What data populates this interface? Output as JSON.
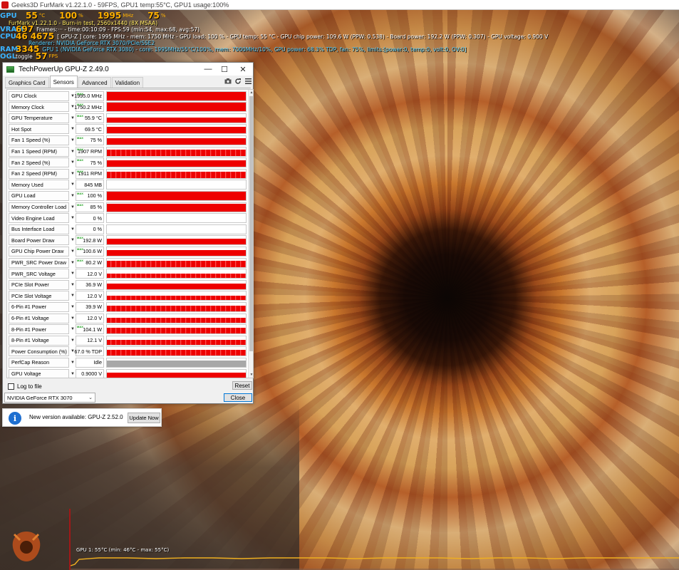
{
  "furmark": {
    "window_title": "Geeks3D FurMark v1.22.1.0 - 59FPS, GPU1 temp:55°C, GPU1 usage:100%",
    "osd": {
      "gpu_label": "GPU",
      "gpu_temp": "55",
      "gpu_temp_unit": "°C",
      "gpu_usage": "100",
      "gpu_usage_unit": "%",
      "gpu_clock": "1995",
      "gpu_clock_unit": "MHz",
      "fan": "75",
      "fan_unit": "%",
      "line1": "FurMark v1.22.1.0 - Burn-in test, 2560x1440 (8X MSAA)",
      "vram_label": "VRAM",
      "vram_value": "697",
      "line2": "Frames:··· - time:00:10:09 - FPS:59 (min:54, max:68, avg:57)",
      "cpu_label": "CPU",
      "cpu_value": "46",
      "cpu_value2": "4675",
      "line3": "[ GPU-Z ] core: 1995 MHz - mem: 1750 MHz - GPU load: 100 % - GPU temp: 55 °C - GPU chip power: 109.6 W (PPW: 0.538) - Board power: 192.2 W (PPW: 0.307) - GPU voltage: 0.900 V",
      "line4": "Renderer: NVIDIA GeForce RTX 3070/PCIe/SSE2",
      "ram_label": "RAM",
      "ram_value": "3345",
      "line5": "GPU 1 (NVIDIA GeForce RTX 3080) - core: 1995MHz/55°C/100%, mem: 7000MHz/10%, GPU power: 68.3% TDP, fan: 75%, limits:[power:0, temp:0, volt:0, OV:0]",
      "ogl_label": "OGL",
      "ogl_value": "57",
      "ogl_unit": "FPS",
      "toggle_text": "toggle"
    },
    "graph_label": "GPU 1: 55°C (min: 46°C - max: 55°C)"
  },
  "gpuz": {
    "title": "TechPowerUp GPU-Z 2.49.0",
    "min_glyph": "—",
    "max_glyph": "☐",
    "close_glyph": "✕",
    "tabs": [
      {
        "label": "Graphics Card",
        "active": false
      },
      {
        "label": "Sensors",
        "active": true
      },
      {
        "label": "Advanced",
        "active": false
      },
      {
        "label": "Validation",
        "active": false
      }
    ],
    "toolbar_icons": [
      "camera-icon",
      "refresh-icon",
      "menu-icon"
    ],
    "sensors": [
      {
        "name": "GPU Clock",
        "value": "1995.0 MHz",
        "max": true,
        "fill": 0.98,
        "style": "solid"
      },
      {
        "name": "Memory Clock",
        "value": "1750.2 MHz",
        "max": true,
        "fill": 0.98,
        "style": "solid"
      },
      {
        "name": "GPU Temperature",
        "value": "55.9 °C",
        "max": true,
        "fill": 0.6,
        "style": "solid"
      },
      {
        "name": "Hot Spot",
        "value": "69.5 °C",
        "max": false,
        "fill": 0.75,
        "style": "solid"
      },
      {
        "name": "Fan 1 Speed (%)",
        "value": "75 %",
        "max": true,
        "fill": 0.72,
        "style": "solid"
      },
      {
        "name": "Fan 1 Speed (RPM)",
        "value": "1907 RPM",
        "max": true,
        "fill": 0.7,
        "style": "noisy"
      },
      {
        "name": "Fan 2 Speed (%)",
        "value": "75 %",
        "max": true,
        "fill": 0.72,
        "style": "solid"
      },
      {
        "name": "Fan 2 Speed (RPM)",
        "value": "1911 RPM",
        "max": true,
        "fill": 0.7,
        "style": "noisy"
      },
      {
        "name": "Memory Used",
        "value": "845 MB",
        "max": false,
        "fill": 0.0,
        "style": "solid"
      },
      {
        "name": "GPU Load",
        "value": "100 %",
        "max": true,
        "fill": 0.98,
        "style": "solid"
      },
      {
        "name": "Memory Controller Load",
        "value": "85 %",
        "max": true,
        "fill": 0.88,
        "style": "solid"
      },
      {
        "name": "Video Engine Load",
        "value": "0 %",
        "max": false,
        "fill": 0.0,
        "style": "solid"
      },
      {
        "name": "Bus Interface Load",
        "value": "0 %",
        "max": false,
        "fill": 0.0,
        "style": "solid"
      },
      {
        "name": "Board Power Draw",
        "value": "192.8 W",
        "max": true,
        "fill": 0.7,
        "style": "solid"
      },
      {
        "name": "GPU Chip Power Draw",
        "value": "100.6 W",
        "max": true,
        "fill": 0.7,
        "style": "solid"
      },
      {
        "name": "PWR_SRC Power Draw",
        "value": "80.2 W",
        "max": true,
        "fill": 0.7,
        "style": "noisy"
      },
      {
        "name": "PWR_SRC Voltage",
        "value": "12.0 V",
        "max": false,
        "fill": 0.55,
        "style": "noisy"
      },
      {
        "name": "PCIe Slot Power",
        "value": "36.9 W",
        "max": false,
        "fill": 0.65,
        "style": "solid"
      },
      {
        "name": "PCIe Slot Voltage",
        "value": "12.0 V",
        "max": false,
        "fill": 0.55,
        "style": "noisy"
      },
      {
        "name": "6-Pin #1 Power",
        "value": "39.9 W",
        "max": false,
        "fill": 0.7,
        "style": "noisy"
      },
      {
        "name": "6-Pin #1 Voltage",
        "value": "12.0 V",
        "max": false,
        "fill": 0.55,
        "style": "noisy"
      },
      {
        "name": "8-Pin #1 Power",
        "value": "104.1 W",
        "max": true,
        "fill": 0.7,
        "style": "noisy"
      },
      {
        "name": "8-Pin #1 Voltage",
        "value": "12.1 V",
        "max": false,
        "fill": 0.55,
        "style": "noisy"
      },
      {
        "name": "Power Consumption (%)",
        "value": "67.0 % TDP",
        "max": false,
        "fill": 0.7,
        "style": "noisy"
      },
      {
        "name": "PerfCap Reason",
        "value": "Idle",
        "max": false,
        "fill": 0.75,
        "style": "gray"
      },
      {
        "name": "GPU Voltage",
        "value": "0.9000 V",
        "max": false,
        "fill": 0.6,
        "style": "solid"
      }
    ],
    "max_marker": "MAX",
    "dropdown_glyph": "▼",
    "log_label": "Log to file",
    "reset_label": "Reset",
    "close_label": "Close",
    "gpu_selected": "NVIDIA GeForce RTX 3070",
    "select_arrow": "⌄"
  },
  "notification": {
    "icon_glyph": "i",
    "text": "New version available: GPU-Z 2.52.0",
    "button_label": "Update Now"
  },
  "colors": {
    "bar_red": "#ee0000",
    "bar_gray": "#a8a8a8",
    "osd_orange": "#ffb000",
    "osd_cyan": "#58d0ff",
    "info_blue": "#1e6fd0"
  }
}
